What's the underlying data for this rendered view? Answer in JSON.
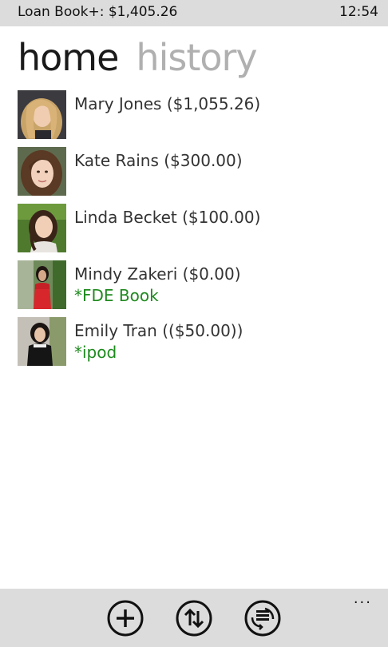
{
  "status_bar": {
    "title": "Loan Book+: $1,405.26",
    "time": "12:54"
  },
  "pivot": {
    "items": [
      {
        "label": "home",
        "active": true
      },
      {
        "label": "history",
        "active": false
      }
    ]
  },
  "loans": [
    {
      "name_amount": "Mary Jones ($1,055.26)",
      "note": ""
    },
    {
      "name_amount": "Kate Rains ($300.00)",
      "note": ""
    },
    {
      "name_amount": "Linda Becket ($100.00)",
      "note": ""
    },
    {
      "name_amount": "Mindy Zakeri ($0.00)",
      "note": "*FDE Book"
    },
    {
      "name_amount": "Emily Tran (($50.00))",
      "note": "*ipod"
    }
  ],
  "app_bar": {
    "buttons": [
      {
        "icon": "add-icon"
      },
      {
        "icon": "sort-icon"
      },
      {
        "icon": "sync-icon"
      }
    ],
    "more": "..."
  },
  "colors": {
    "note": "#1e8a1e",
    "chrome": "#dcdcdc",
    "pivot_inactive": "#b0b0b0"
  }
}
